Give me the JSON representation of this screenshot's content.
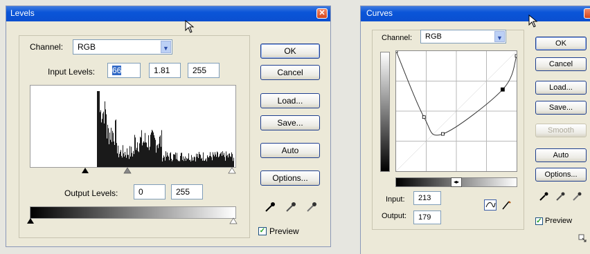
{
  "levels": {
    "title": "Levels",
    "close_glyph": "✕",
    "channel_label": "Channel:",
    "channel_value": "RGB",
    "input_levels_label": "Input Levels:",
    "input_levels": [
      "66",
      "1.81",
      "255"
    ],
    "output_levels_label": "Output Levels:",
    "output_levels": [
      "0",
      "255"
    ],
    "buttons": {
      "ok": "OK",
      "cancel": "Cancel",
      "load": "Load...",
      "save": "Save...",
      "auto": "Auto",
      "options": "Options..."
    },
    "preview_label": "Preview",
    "preview_checked": true,
    "histogram_color": "#1a1a1a",
    "highlight_color": "#3169c6"
  },
  "curves": {
    "title": "Curves",
    "channel_label": "Channel:",
    "channel_value": "RGB",
    "input_label": "Input:",
    "input_value": "213",
    "output_label": "Output:",
    "output_value": "179",
    "buttons": {
      "ok": "OK",
      "cancel": "Cancel",
      "load": "Load...",
      "save": "Save...",
      "smooth": "Smooth",
      "auto": "Auto",
      "options": "Options..."
    },
    "preview_label": "Preview",
    "preview_checked": true,
    "curve_points": [
      [
        0,
        100
      ],
      [
        40,
        45
      ],
      [
        67,
        31
      ],
      [
        153,
        68
      ],
      [
        173,
        96
      ]
    ],
    "tool_icons": [
      "curve-tool-icon",
      "pencil-tool-icon"
    ]
  },
  "icons": [
    "close-icon",
    "cursor-icon",
    "chevron-down-icon",
    "eyedropper-black-icon",
    "eyedropper-gray-icon",
    "eyedropper-white-icon",
    "checkmark-icon",
    "expand-icon"
  ]
}
